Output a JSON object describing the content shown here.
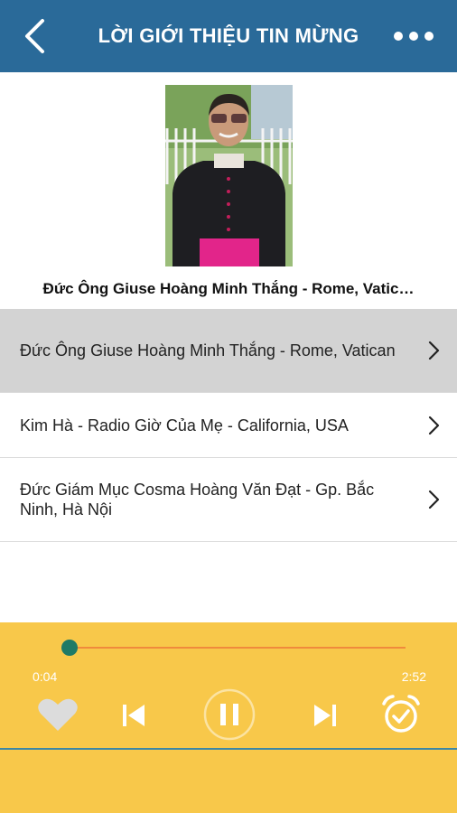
{
  "header": {
    "title": "LỜI GIỚI THIỆU TIN MỪNG",
    "back_icon": "chevron-left-icon",
    "more_icon": "more-horizontal-icon",
    "background_color": "#2a6a99"
  },
  "hero": {
    "caption": "Đức Ông Giuse Hoàng Minh Thắng - Rome, Vatic…"
  },
  "tracks": [
    {
      "label": "Đức Ông Giuse Hoàng Minh Thắng - Rome, Vatican",
      "active": true
    },
    {
      "label": "Kim Hà - Radio Giờ Của Mẹ - California, USA",
      "active": false
    },
    {
      "label": "Đức Giám Mục Cosma Hoàng Văn Đạt - Gp. Bắc Ninh, Hà Nội",
      "active": false
    }
  ],
  "player": {
    "elapsed": "0:04",
    "total": "2:52",
    "progress_fraction": 0.023,
    "state": "playing",
    "background_color": "#f8c84a",
    "icons": {
      "favorite": "heart-icon",
      "previous": "skip-previous-icon",
      "play_pause": "pause-icon",
      "next": "skip-next-icon",
      "alarm": "alarm-clock-icon"
    }
  }
}
